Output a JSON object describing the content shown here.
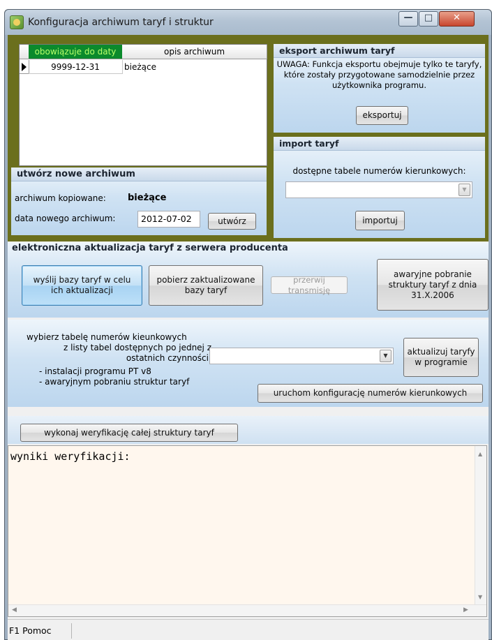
{
  "window": {
    "title": "Konfiguracja archiwum taryf i struktur"
  },
  "archive_table": {
    "columns": [
      "obowiązuje do daty",
      "opis archiwum"
    ],
    "rows": [
      {
        "date": "9999-12-31",
        "description": "bieżące"
      }
    ]
  },
  "export": {
    "title": "eksport archiwum taryf",
    "note": "UWAGA: Funkcja eksportu obejmuje tylko te taryfy, które zostały przygotowane samodzielnie przez użytkownika programu.",
    "button": "eksportuj"
  },
  "import": {
    "title": "import taryf",
    "label": "dostępne tabele numerów kierunkowych:",
    "selected": "",
    "button": "importuj"
  },
  "new_archive": {
    "title": "utwórz nowe archiwum",
    "copied_label": "archiwum kopiowane:",
    "copied_value": "bieżące",
    "date_label": "data nowego archiwum:",
    "date_value": "2012-07-02",
    "button": "utwórz"
  },
  "update": {
    "title": "elektroniczna aktualizacja taryf z serwera producenta",
    "send_button": "wyślij bazy taryf w celu ich aktualizacji",
    "download_button": "pobierz zaktualizowane bazy taryf",
    "abort_button": "przerwij transmisję",
    "emergency_button": "awaryjne pobranie struktury taryf z dnia 31.X.2006"
  },
  "table_select": {
    "label_line1": "wybierz tabelę numerów kieunkowych",
    "label_line2": "z listy tabel dostępnych po jednej z",
    "label_line3": "ostatnich czynności:",
    "option1": "- instalacji programu PT v8",
    "option2": "- awaryjnym pobraniu struktur taryf",
    "selected": "",
    "update_button": "aktualizuj taryfy w programie",
    "config_button": "uruchom konfigurację numerów kierunkowych"
  },
  "verify": {
    "button": "wykonaj weryfikację całej struktury taryf",
    "results_text": "wyniki weryfikacji:"
  },
  "status_bar": {
    "text": "F1 Pomoc"
  }
}
